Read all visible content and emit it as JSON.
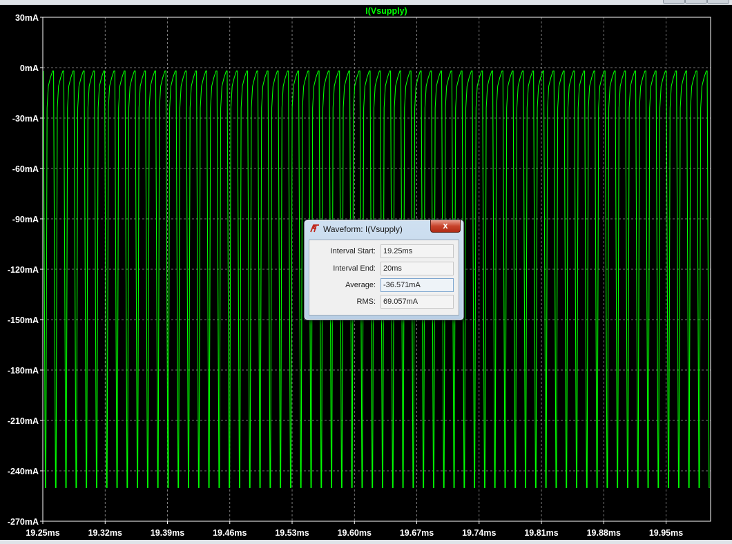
{
  "colors": {
    "background": "#000000",
    "trace": "#00ff00",
    "grid": "#9a9a9a",
    "axis_labels": "#ffffff",
    "title": "#00ff00"
  },
  "chart_data": {
    "type": "line",
    "title": "I(Vsupply)",
    "xlabel": "",
    "ylabel": "",
    "xlim": [
      19.25,
      20.0
    ],
    "ylim": [
      -270,
      30
    ],
    "x_unit": "ms",
    "y_unit": "mA",
    "x_ticks": [
      "19.25ms",
      "19.32ms",
      "19.39ms",
      "19.46ms",
      "19.53ms",
      "19.60ms",
      "19.67ms",
      "19.74ms",
      "19.81ms",
      "19.88ms",
      "19.95ms"
    ],
    "y_ticks": [
      "30mA",
      "0mA",
      "-30mA",
      "-60mA",
      "-90mA",
      "-120mA",
      "-150mA",
      "-180mA",
      "-210mA",
      "-240mA",
      "-270mA"
    ],
    "grid": true,
    "series": [
      {
        "waveform": "periodic current pulses",
        "period_ms": 0.01147,
        "pulse_count": 65,
        "max_mA": -2,
        "min_mA": -250,
        "points": [
          [
            19.25,
            -2
          ],
          [
            19.2532,
            -250
          ],
          [
            19.2538,
            -250
          ],
          [
            19.2553,
            -20
          ],
          [
            19.2573,
            -8
          ],
          [
            19.2615,
            -2
          ],
          [
            19.2647,
            -250
          ],
          [
            19.2653,
            -250
          ],
          [
            19.2668,
            -20
          ],
          [
            19.2688,
            -8
          ],
          [
            19.273,
            -2
          ]
        ]
      }
    ]
  },
  "dialog": {
    "title": "Waveform: I(Vsupply)",
    "close_glyph": "x",
    "fields": [
      {
        "label": "Interval Start:",
        "value": "19.25ms"
      },
      {
        "label": "Interval End:",
        "value": "20ms"
      },
      {
        "label": "Average:",
        "value": "-36.571mA"
      },
      {
        "label": "RMS:",
        "value": "69.057mA"
      }
    ]
  }
}
